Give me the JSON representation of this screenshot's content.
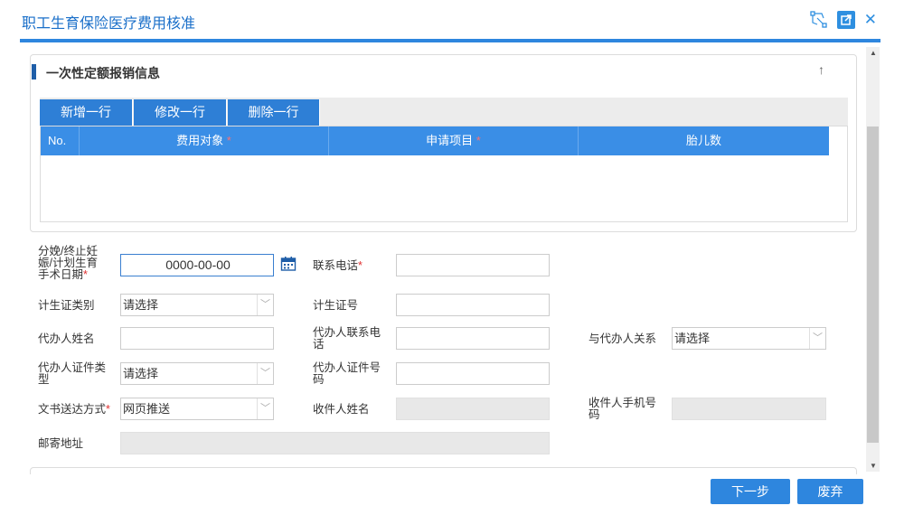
{
  "window": {
    "title": "职工生育保险医疗费用核准",
    "close_glyph": "✕"
  },
  "panel": {
    "heading": "一次性定额报销信息",
    "collapse_glyph": "↑",
    "toolbar": {
      "add_row": "新增一行",
      "edit_row": "修改一行",
      "delete_row": "删除一行"
    },
    "grid": {
      "columns": [
        {
          "label": "No.",
          "required": false
        },
        {
          "label": "费用对象",
          "required": true
        },
        {
          "label": "申请项目",
          "required": true
        },
        {
          "label": "胎儿数",
          "required": false
        }
      ],
      "required_mark": "*"
    }
  },
  "form": {
    "surgery_date": {
      "label_1": "分娩/终止妊",
      "label_2": "娠/计划生育",
      "label_3": "手术日期",
      "value": "0000-00-00"
    },
    "phone": {
      "label": "联系电话",
      "value": ""
    },
    "birth_permit_type": {
      "label": "计生证类别",
      "value": "请选择"
    },
    "birth_permit_no": {
      "label": "计生证号",
      "value": ""
    },
    "agent_name": {
      "label": "代办人姓名",
      "value": ""
    },
    "agent_phone": {
      "label_1": "代办人联系电",
      "label_2": "话",
      "value": ""
    },
    "agent_relation": {
      "label": "与代办人关系",
      "value": "请选择"
    },
    "agent_id_type": {
      "label_1": "代办人证件类",
      "label_2": "型",
      "value": "请选择"
    },
    "agent_id_no": {
      "label_1": "代办人证件号",
      "label_2": "码",
      "value": ""
    },
    "delivery_method": {
      "label": "文书送达方式",
      "value": "网页推送"
    },
    "recipient_name": {
      "label": "收件人姓名",
      "value": ""
    },
    "recipient_phone": {
      "label_1": "收件人手机号",
      "label_2": "码",
      "value": ""
    },
    "mail_address": {
      "label": "邮寄地址",
      "value": ""
    },
    "required_mark": "*"
  },
  "footer": {
    "next_label": "下一步",
    "discard_label": "废弃"
  },
  "colors": {
    "accent": "#2e86de",
    "title": "#1a6fc9"
  }
}
